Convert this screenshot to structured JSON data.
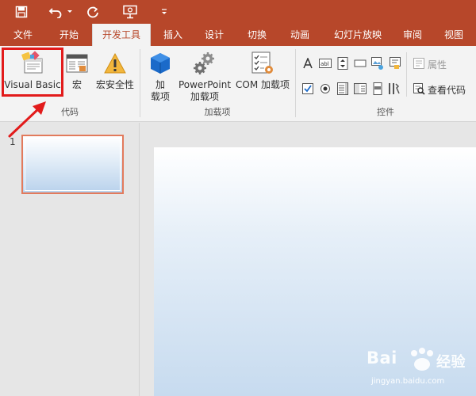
{
  "tabs": [
    "文件",
    "开始",
    "开发工具",
    "插入",
    "设计",
    "切换",
    "动画",
    "幻灯片放映",
    "审阅",
    "视图"
  ],
  "active_tab_index": 2,
  "ribbon": {
    "code_group": {
      "label": "代码",
      "visual_basic": "Visual Basic",
      "macro": "宏",
      "macro_security": "宏安全性"
    },
    "addins_group": {
      "label": "加载项",
      "addins_line1": "加",
      "addins_line2": "载项",
      "pp_addins_line1": "PowerPoint",
      "pp_addins_line2": "加载项",
      "com_addins": "COM 加载项"
    },
    "controls_group": {
      "label": "控件",
      "properties": "属性",
      "view_code": "查看代码"
    }
  },
  "slides": {
    "number": "1"
  },
  "watermark": {
    "text_a": "Bai",
    "text_b": "经验",
    "url": "jingyan.baidu.com"
  },
  "colors": {
    "accent": "#b7472a",
    "highlight": "#e21b1b",
    "ribbon_bg": "#f3f3f3"
  }
}
